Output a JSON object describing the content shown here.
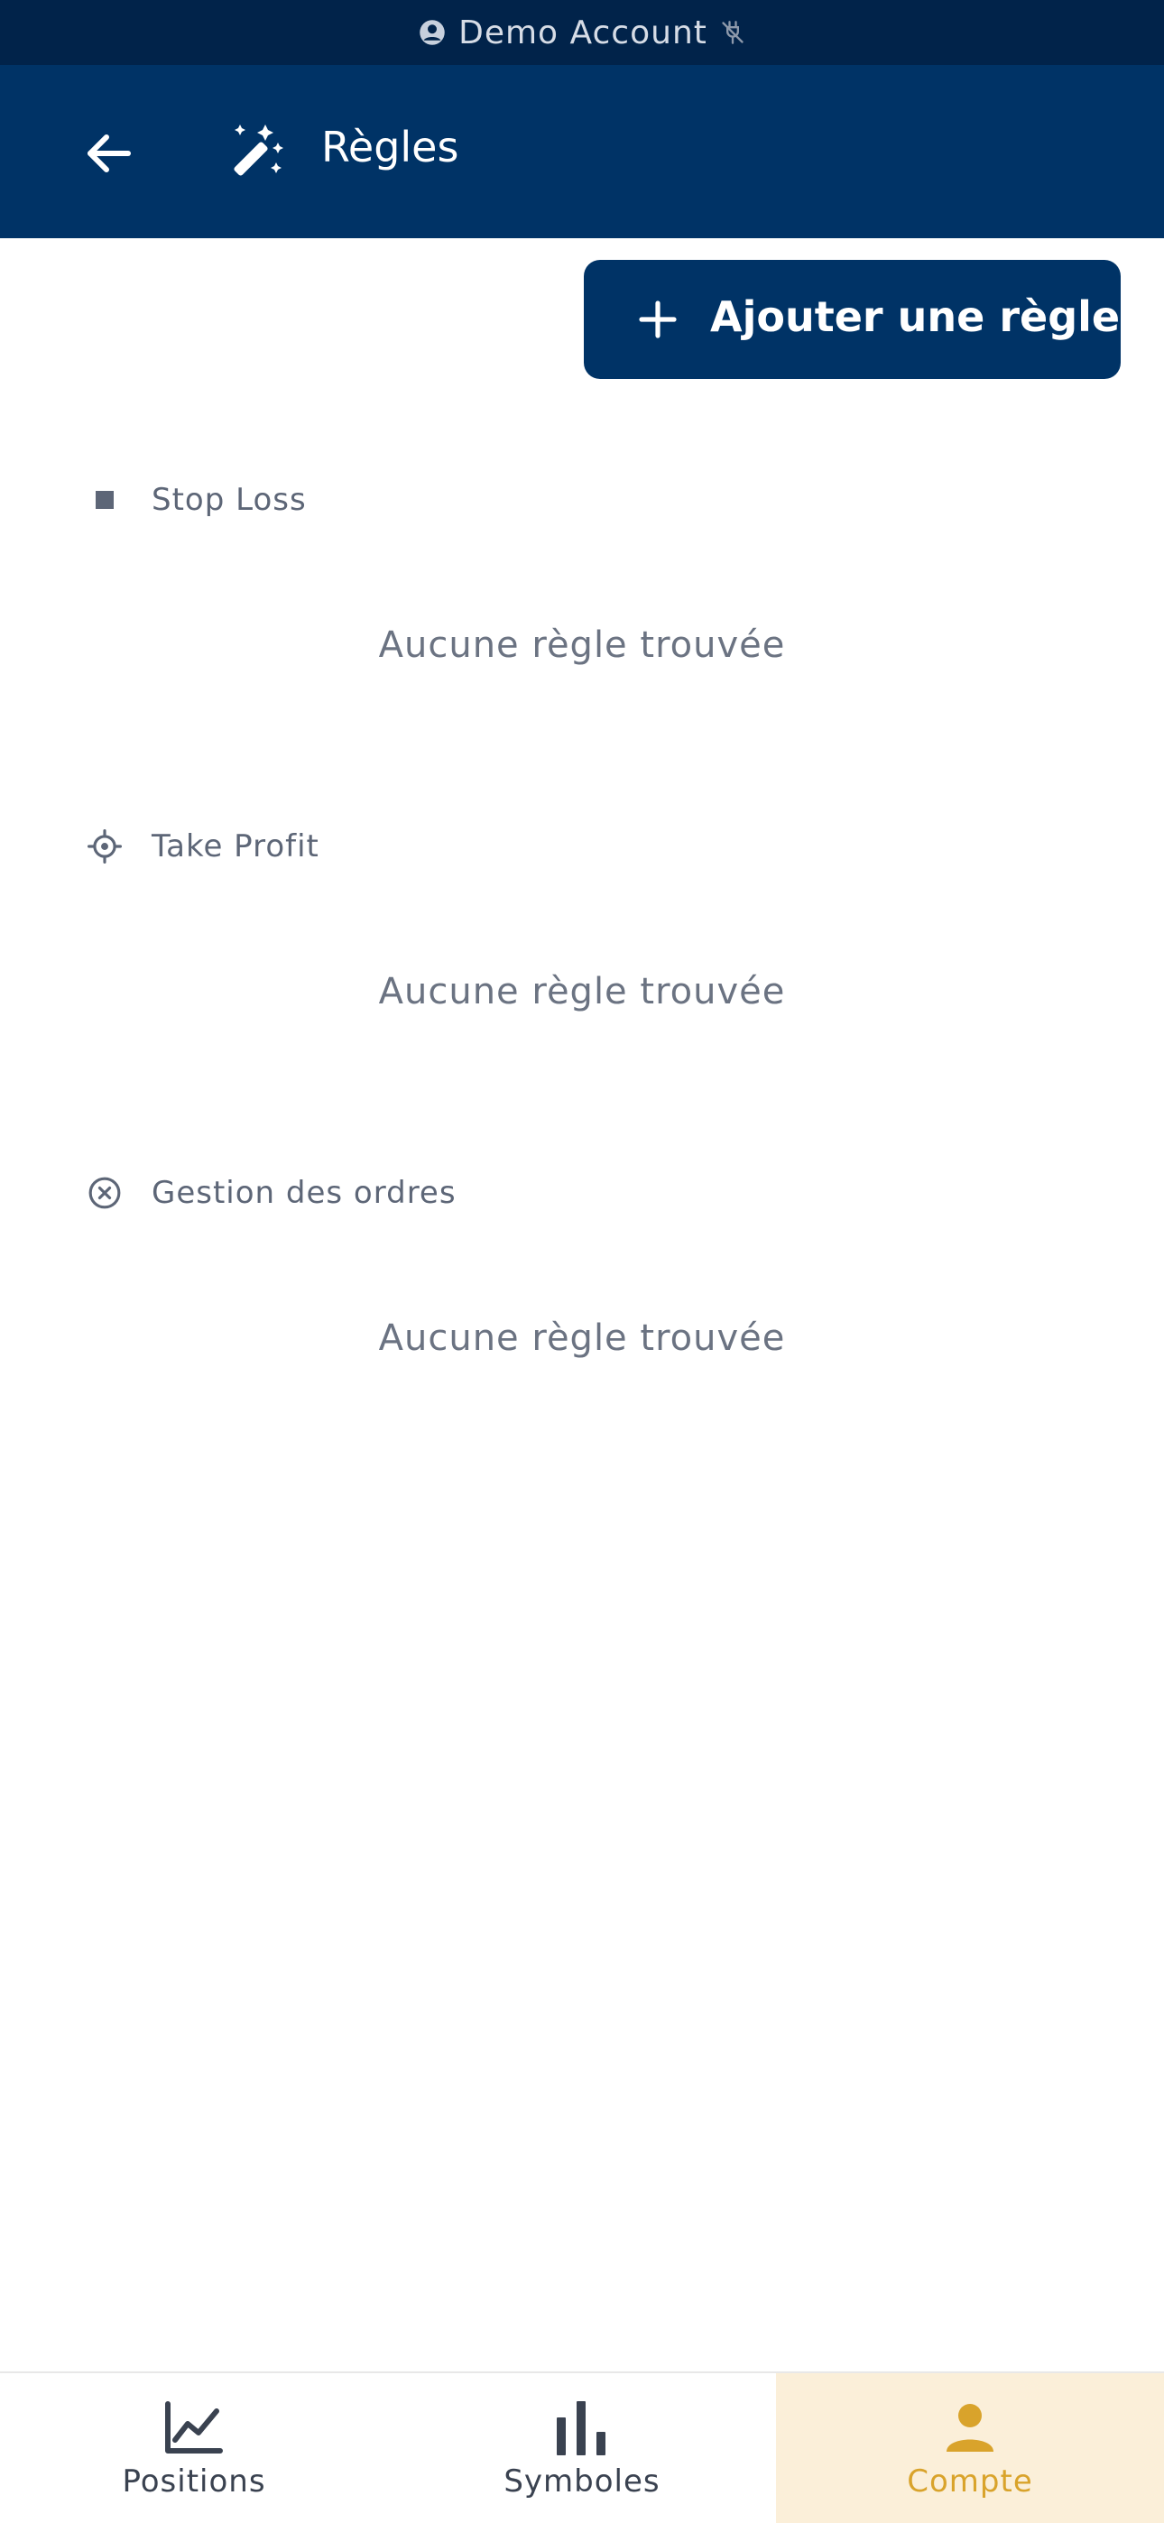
{
  "status_bar": {
    "account_label": "Demo Account",
    "account_icon": "user-circle-icon",
    "connection_icon": "plug-off-icon"
  },
  "header": {
    "title": "Règles",
    "back_icon": "arrow-left-icon",
    "title_icon": "magic-wand-icon"
  },
  "toolbar": {
    "add_rule_label": "Ajouter une règle",
    "add_icon": "plus-icon"
  },
  "sections": [
    {
      "title": "Stop Loss",
      "icon": "stop-square-icon",
      "empty_text": "Aucune règle trouvée"
    },
    {
      "title": "Take Profit",
      "icon": "crosshair-icon",
      "empty_text": "Aucune règle trouvée"
    },
    {
      "title": "Gestion des ordres",
      "icon": "x-circle-icon",
      "empty_text": "Aucune règle trouvée"
    }
  ],
  "bottom_nav": {
    "items": [
      {
        "label": "Positions",
        "icon": "line-chart-icon",
        "active": false
      },
      {
        "label": "Symboles",
        "icon": "bar-chart-icon",
        "active": false
      },
      {
        "label": "Compte",
        "icon": "user-icon",
        "active": true
      }
    ]
  },
  "colors": {
    "status_bar_bg": "#01234a",
    "header_bg": "#003366",
    "accent_active": "#d9a32b",
    "active_tab_bg": "#fbefd9",
    "muted_text": "#6b7382"
  }
}
